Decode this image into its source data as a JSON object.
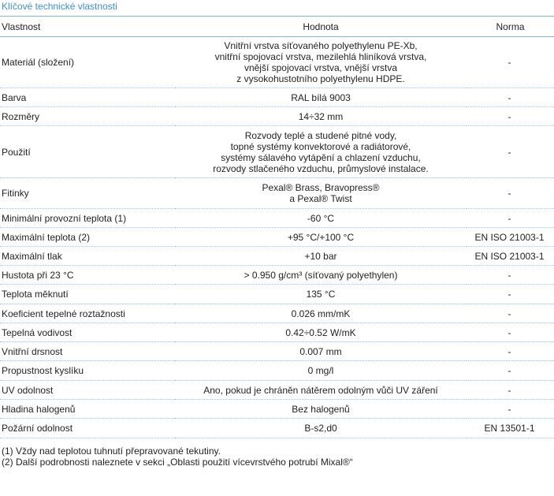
{
  "title": "Klíčové technické vlastnosti",
  "headers": {
    "property": "Vlastnost",
    "value": "Hodnota",
    "norm": "Norma"
  },
  "rows": [
    {
      "property": "Materiál (složení)",
      "value": "Vnitřní vrstva síťovaného polyethylenu PE-Xb,\nvnitřní spojovací vrstva, mezilehlá hliníková vrstva,\nvnější spojovací vrstva, vnější vrstva\nz vysokohustotního polyethylenu HDPE.",
      "norm": "-"
    },
    {
      "property": "Barva",
      "value": "RAL bílá 9003",
      "norm": "-"
    },
    {
      "property": "Rozměry",
      "value": "14÷32 mm",
      "norm": "-"
    },
    {
      "property": "Použití",
      "value": "Rozvody teplé a studené pitné vody,\ntopné systémy konvektorové a radiátorové,\nsystémy sálavého vytápění a chlazení vzduchu,\nrozvody stlačeného vzduchu, průmyslové instalace.",
      "norm": "-"
    },
    {
      "property": "Fitinky",
      "value": "Pexal® Brass, Bravopress®\na  Pexal® Twist",
      "norm": "-"
    },
    {
      "property": "Minimální provozní teplota (1)",
      "value": "-60 °C",
      "norm": "-"
    },
    {
      "property": "Maximální teplota  (2)",
      "value": "+95 °C/+100 °C",
      "norm": "EN ISO 21003-1"
    },
    {
      "property": "Maximální tlak",
      "value": "+10 bar",
      "norm": "EN ISO 21003-1"
    },
    {
      "property": "Hustota při 23 °C",
      "value": "> 0.950 g/cm³ (síťovaný polyethylen)",
      "norm": "-"
    },
    {
      "property": "Teplota měknutí",
      "value": "135 °C",
      "norm": "-"
    },
    {
      "property": "Koeficient tepelné roztažnosti",
      "value": "0.026 mm/mK",
      "norm": "-"
    },
    {
      "property": "Tepelná vodivost",
      "value": "0.42÷0.52 W/mK",
      "norm": "-"
    },
    {
      "property": "Vnitřní drsnost",
      "value": "0.007 mm",
      "norm": "-"
    },
    {
      "property": "Propustnost kyslíku",
      "value": "0 mg/l",
      "norm": "-"
    },
    {
      "property": "UV odolnost",
      "value": "Ano, pokud je chráněn nátěrem odolným vůči UV záření",
      "norm": "-"
    },
    {
      "property": "Hladina halogenů",
      "value": "Bez halogenů",
      "norm": "-"
    },
    {
      "property": "Požární odolnost",
      "value": "B-s2,d0",
      "norm": "EN 13501-1"
    }
  ],
  "notes": [
    "(1) Vždy nad teplotou tuhnutí přepravované tekutiny.",
    "(2) Další podrobnosti naleznete v sekci „Oblasti použití vícevrstvého potrubí Mixal®“"
  ],
  "colors": {
    "title": "#3d8fd0",
    "border": "#7bb3de",
    "dotted": "#9ec7e6"
  }
}
